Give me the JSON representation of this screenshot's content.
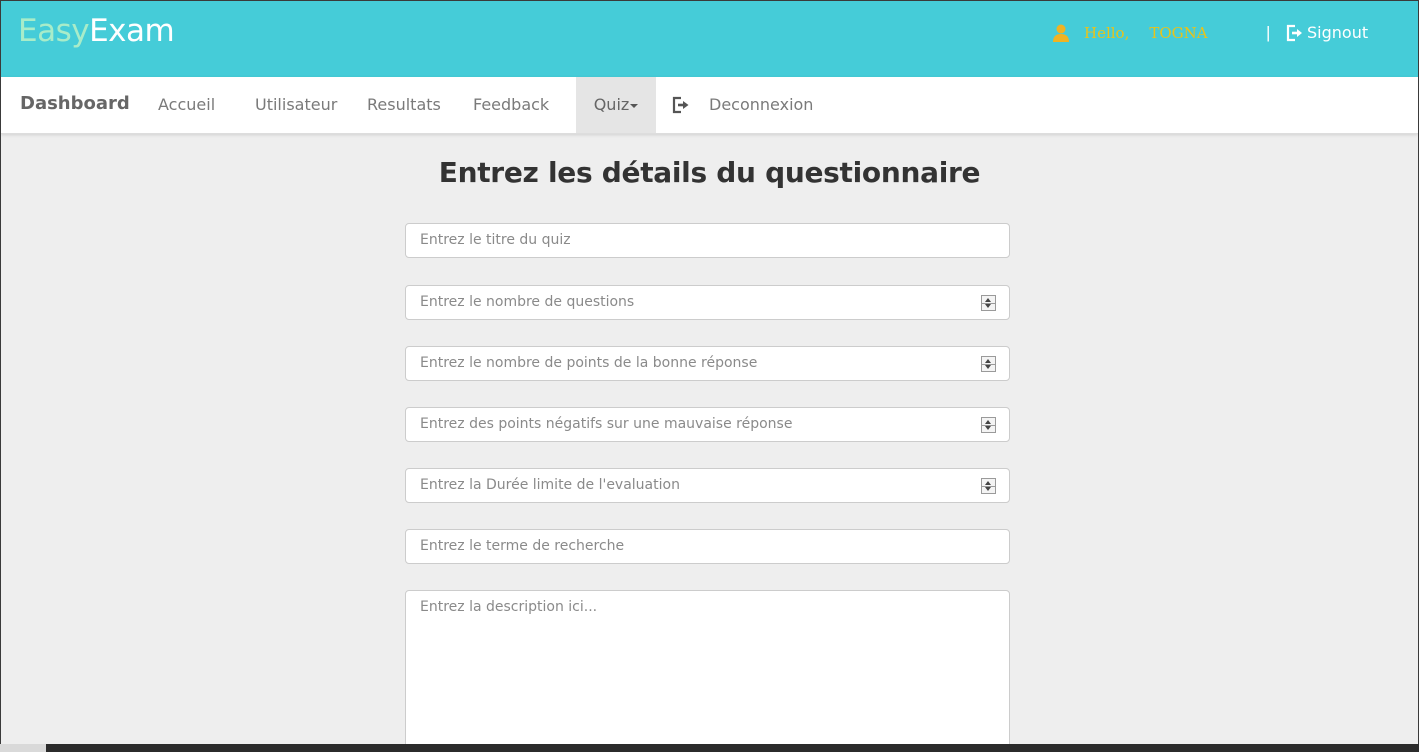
{
  "header": {
    "logo_part1": "Easy",
    "logo_part2": "Exam",
    "greeting": "Hello,",
    "username": "TOGNA",
    "divider": "|",
    "signout_label": "Signout",
    "icons": {
      "user": "user-icon",
      "signout": "signout-icon"
    },
    "colors": {
      "background": "#45ccd8",
      "greeting": "#e8c31a"
    }
  },
  "nav": {
    "brand": "Dashboard",
    "items": [
      {
        "label": "Accueil"
      },
      {
        "label": "Utilisateur"
      },
      {
        "label": "Resultats"
      },
      {
        "label": "Feedback"
      },
      {
        "label": "Quiz",
        "active": true,
        "dropdown": true
      },
      {
        "label": "Deconnexion",
        "icon": "logout-icon"
      }
    ]
  },
  "form": {
    "title": "Entrez les détails du questionnaire",
    "fields": [
      {
        "placeholder": "Entrez le titre du quiz",
        "type": "text"
      },
      {
        "placeholder": "Entrez le nombre de questions",
        "type": "number"
      },
      {
        "placeholder": "Entrez le nombre de points de la bonne réponse",
        "type": "number"
      },
      {
        "placeholder": "Entrez des points négatifs sur une mauvaise réponse",
        "type": "number"
      },
      {
        "placeholder": "Entrez la Durée limite de l'evaluation",
        "type": "number"
      },
      {
        "placeholder": "Entrez le terme de recherche",
        "type": "text"
      }
    ],
    "description_placeholder": "Entrez la description ici..."
  }
}
